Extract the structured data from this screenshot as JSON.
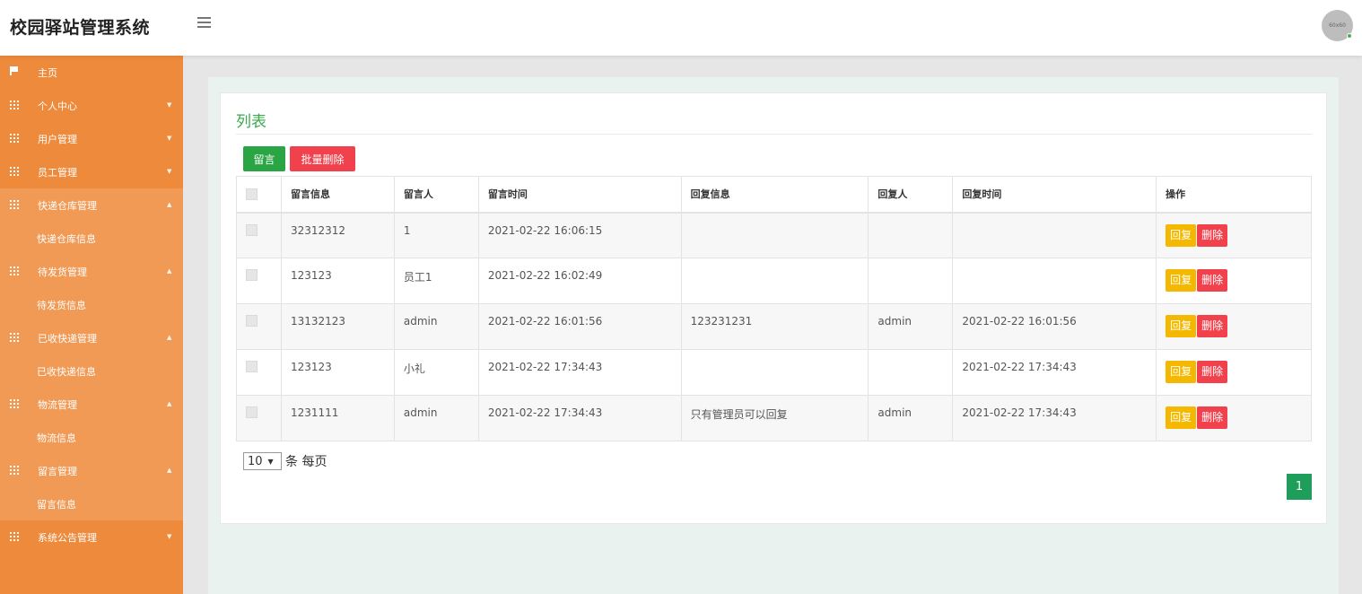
{
  "header": {
    "app_title": "校园驿站管理系统",
    "avatar_text": "60x60"
  },
  "sidebar": {
    "items": [
      {
        "label": "主页",
        "icon": "flag-icon",
        "chevron": ""
      },
      {
        "label": "个人中心",
        "icon": "grid-icon",
        "chevron": "▼"
      },
      {
        "label": "用户管理",
        "icon": "grid-icon",
        "chevron": "▼"
      },
      {
        "label": "员工管理",
        "icon": "grid-icon",
        "chevron": "▼"
      },
      {
        "label": "快递仓库管理",
        "icon": "grid-icon",
        "chevron": "▲",
        "sub": "快递仓库信息"
      },
      {
        "label": "待发货管理",
        "icon": "grid-icon",
        "chevron": "▲",
        "sub": "待发货信息"
      },
      {
        "label": "已收快递管理",
        "icon": "grid-icon",
        "chevron": "▲",
        "sub": "已收快递信息"
      },
      {
        "label": "物流管理",
        "icon": "grid-icon",
        "chevron": "▲",
        "sub": "物流信息"
      },
      {
        "label": "留言管理",
        "icon": "grid-icon",
        "chevron": "▲",
        "sub": "留言信息"
      },
      {
        "label": "系统公告管理",
        "icon": "grid-icon",
        "chevron": "▼"
      }
    ]
  },
  "main": {
    "title": "列表",
    "add_button": "留言",
    "batch_delete_button": "批量删除",
    "table": {
      "headers": [
        "留言信息",
        "留言人",
        "留言时间",
        "回复信息",
        "回复人",
        "回复时间",
        "操作"
      ],
      "rows": [
        [
          "32312312",
          "1",
          "2021-02-22 16:06:15",
          "",
          "",
          ""
        ],
        [
          "123123",
          "员工1",
          "2021-02-22 16:02:49",
          "",
          "",
          ""
        ],
        [
          "13132123",
          "admin",
          "2021-02-22 16:01:56",
          "123231231",
          "admin",
          "2021-02-22 16:01:56"
        ],
        [
          "123123",
          "小礼",
          "2021-02-22 17:34:43",
          "",
          "",
          "2021-02-22 17:34:43"
        ],
        [
          "1231111",
          "admin",
          "2021-02-22 17:34:43",
          "只有管理员可以回复",
          "admin",
          "2021-02-22 17:34:43"
        ]
      ],
      "reply_label": "回复",
      "delete_label": "删除"
    },
    "pagination": {
      "per_page_value": "10",
      "per_page_suffix": "条 每页",
      "current_page": "1"
    }
  },
  "colors": {
    "sidebar": "#ee8a3c",
    "primary_green": "#2aa543",
    "danger_red": "#f0414d",
    "reply_yellow": "#f5b800",
    "title_green": "#3aaa4e"
  }
}
